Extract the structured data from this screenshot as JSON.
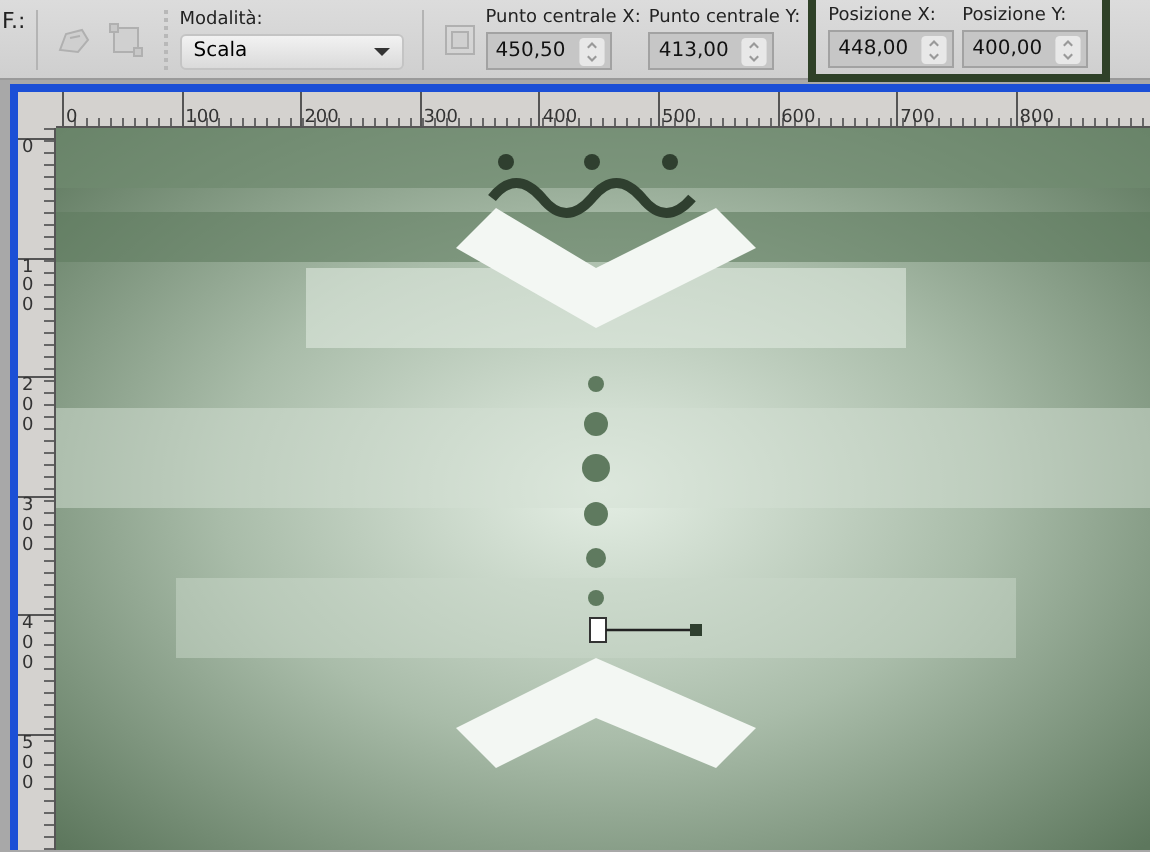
{
  "toolbar": {
    "cut_label": "F.:",
    "mode": {
      "label": "Modalità:",
      "value": "Scala"
    },
    "fields": [
      {
        "label": "Punto centrale X:",
        "value": "450,50",
        "highlighted": false
      },
      {
        "label": "Punto centrale Y:",
        "value": "413,00",
        "highlighted": false
      },
      {
        "label": "Posizione X:",
        "value": "448,00",
        "highlighted": true
      },
      {
        "label": "Posizione Y:",
        "value": "400,00",
        "highlighted": true
      }
    ]
  },
  "rulers": {
    "horizontal": [
      "0",
      "100",
      "200",
      "300",
      "400",
      "500",
      "600",
      "700",
      "800"
    ],
    "vertical": [
      "0",
      "100",
      "200",
      "300",
      "400",
      "500"
    ]
  }
}
